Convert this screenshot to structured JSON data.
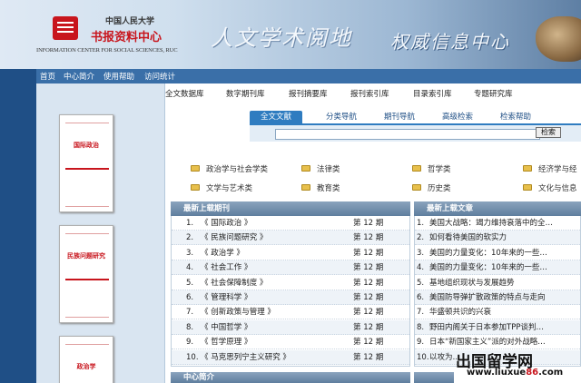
{
  "header": {
    "org_cn": "中国人民大学",
    "center_cn": "书报资料中心",
    "org_en": "INFORMATION CENTER FOR SOCIAL SCIENCES, RUC",
    "slogan_1": "人文学术阅地",
    "slogan_2": "权威信息中心"
  },
  "top_nav": [
    "首页",
    "中心简介",
    "使用帮助",
    "访问统计"
  ],
  "category_nav": [
    "全文数据库",
    "数字期刊库",
    "报刊摘要库",
    "报刊索引库",
    "目录索引库",
    "专题研究库"
  ],
  "search": {
    "tabs": [
      "全文文献",
      "分类导航",
      "期刊导航",
      "高级检索",
      "检索帮助"
    ],
    "active_tab": "全文文献",
    "input_value": "",
    "button_label": "检索"
  },
  "categories": [
    "政治学与社会学类",
    "法律类",
    "哲学类",
    "经济学与经",
    "文学与艺术类",
    "教育类",
    "历史类",
    "文化与信息"
  ],
  "journal_covers": [
    {
      "title": "国际政治"
    },
    {
      "title": "民族问题研究"
    },
    {
      "title": "政治学"
    }
  ],
  "latest_journals": {
    "heading": "最新上载期刊",
    "items": [
      {
        "num": "1.",
        "title": "《 国际政治 》",
        "issue": "第 12 期"
      },
      {
        "num": "2.",
        "title": "《 民族问题研究 》",
        "issue": "第 12 期"
      },
      {
        "num": "3.",
        "title": "《 政治学 》",
        "issue": "第 12 期"
      },
      {
        "num": "4.",
        "title": "《 社会工作 》",
        "issue": "第 12 期"
      },
      {
        "num": "5.",
        "title": "《 社会保障制度 》",
        "issue": "第 12 期"
      },
      {
        "num": "6.",
        "title": "《 管理科学 》",
        "issue": "第 12 期"
      },
      {
        "num": "7.",
        "title": "《 创新政策与管理 》",
        "issue": "第 12 期"
      },
      {
        "num": "8.",
        "title": "《 中国哲学 》",
        "issue": "第 12 期"
      },
      {
        "num": "9.",
        "title": "《 哲学原理 》",
        "issue": "第 12 期"
      },
      {
        "num": "10.",
        "title": "《 马克思列宁主义研究 》",
        "issue": "第 12 期"
      }
    ]
  },
  "latest_articles": {
    "heading": "最新上载文章",
    "items": [
      {
        "num": "1.",
        "title": "美国大战略：竭力维持衰落中的全…"
      },
      {
        "num": "2.",
        "title": "如何看待美国的软实力"
      },
      {
        "num": "3.",
        "title": "美国的力量变化：10年来的一些…"
      },
      {
        "num": "4.",
        "title": "美国的力量变化：10年来的一些…"
      },
      {
        "num": "5.",
        "title": "基地组织现状与发展趋势"
      },
      {
        "num": "6.",
        "title": "美国防导弹扩散政策的特点与走向"
      },
      {
        "num": "7.",
        "title": "华盛顿共识的兴衰"
      },
      {
        "num": "8.",
        "title": "野田内阁关于日本参加TPP谈判…"
      },
      {
        "num": "9.",
        "title": "日本“新国家主义”派的对外战略…"
      },
      {
        "num": "10.",
        "title": "以攻为…"
      }
    ]
  },
  "center_intro": {
    "heading": "中心简介"
  },
  "watermark": {
    "cn": "出国留学网",
    "url_prefix": "www.liuxue",
    "url_num": "86",
    "url_suffix": ".com"
  }
}
